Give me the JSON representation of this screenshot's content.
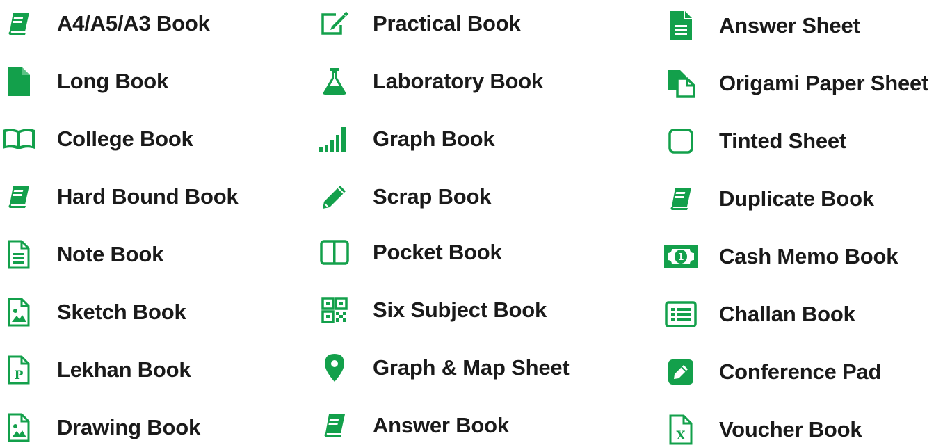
{
  "accent_color": "#13a04b",
  "columns": [
    {
      "items": [
        {
          "label": "A4/A5/A3 Book",
          "icon": "book-icon"
        },
        {
          "label": "Long Book",
          "icon": "file-icon"
        },
        {
          "label": "College Book",
          "icon": "open-book-icon"
        },
        {
          "label": "Hard Bound Book",
          "icon": "book-icon"
        },
        {
          "label": "Note Book",
          "icon": "document-lines-icon"
        },
        {
          "label": "Sketch Book",
          "icon": "image-file-icon"
        },
        {
          "label": "Lekhan Book",
          "icon": "p-file-icon"
        },
        {
          "label": "Drawing Book",
          "icon": "image-file-icon"
        }
      ]
    },
    {
      "items": [
        {
          "label": "Practical Book",
          "icon": "edit-square-icon"
        },
        {
          "label": "Laboratory Book",
          "icon": "flask-icon"
        },
        {
          "label": "Graph Book",
          "icon": "signal-bars-icon"
        },
        {
          "label": "Scrap Book",
          "icon": "pencil-icon"
        },
        {
          "label": "Pocket Book",
          "icon": "columns-icon"
        },
        {
          "label": "Six Subject Book",
          "icon": "qr-code-icon"
        },
        {
          "label": "Graph & Map Sheet",
          "icon": "map-pin-icon"
        },
        {
          "label": "Answer Book",
          "icon": "book-icon"
        }
      ]
    },
    {
      "items": [
        {
          "label": "Answer Sheet",
          "icon": "file-text-icon"
        },
        {
          "label": "Origami Paper Sheet",
          "icon": "copy-icon"
        },
        {
          "label": "Tinted Sheet",
          "icon": "square-outline-icon"
        },
        {
          "label": "Duplicate Book",
          "icon": "book-icon"
        },
        {
          "label": "Cash Memo Book",
          "icon": "money-bill-icon"
        },
        {
          "label": "Challan Book",
          "icon": "list-alt-icon"
        },
        {
          "label": "Conference Pad",
          "icon": "pencil-square-icon"
        },
        {
          "label": "Voucher Book",
          "icon": "excel-file-icon"
        }
      ]
    }
  ]
}
